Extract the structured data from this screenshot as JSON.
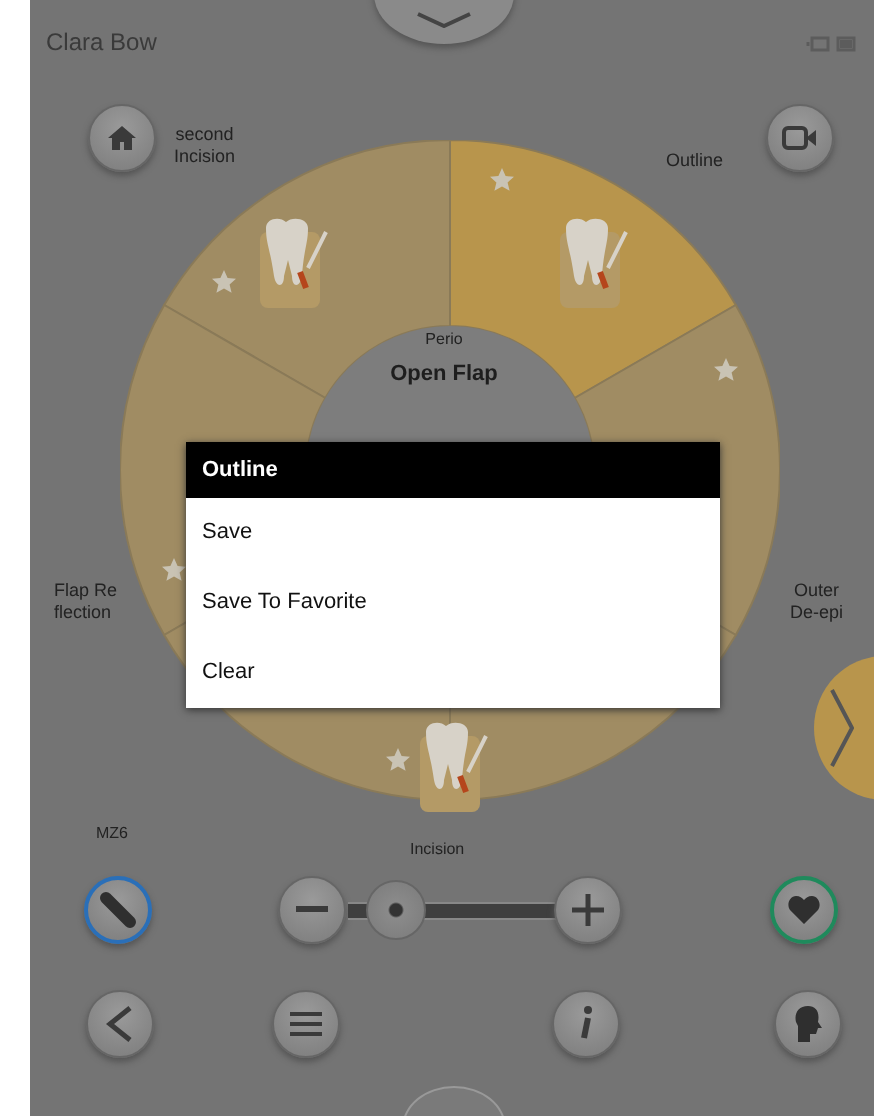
{
  "status_bar": {
    "user": "Clara Bow"
  },
  "wheel": {
    "category": "Perio",
    "procedure": "Open Flap",
    "segments": [
      {
        "label": "second\nIncision",
        "selected": false
      },
      {
        "label": "Outline",
        "selected": true
      },
      {
        "label": "Flap Re\nflection",
        "selected": false
      },
      {
        "label": "Outer\nDe-epi",
        "selected": false
      },
      {
        "selected": false
      },
      {
        "selected": false
      }
    ]
  },
  "dialog": {
    "title": "Outline",
    "items": [
      "Save",
      "Save To Favorite",
      "Clear"
    ]
  },
  "controls": {
    "mode_label": "MZ6",
    "slider_label": "Incision",
    "slider": {
      "level": 0.12
    }
  }
}
